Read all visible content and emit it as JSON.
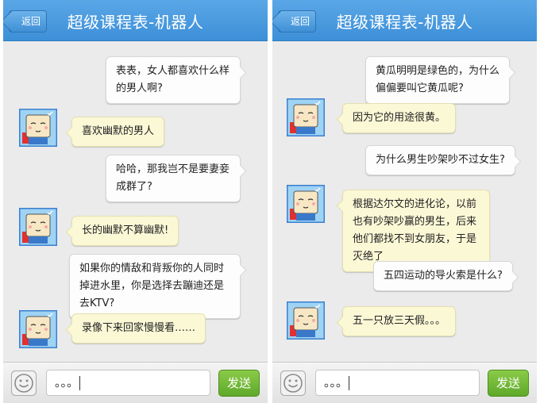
{
  "colors": {
    "navbar": "#4b9be0",
    "incoming_bubble": "#fbf8d6",
    "outgoing_bubble": "#fdfdfd",
    "send_button": "#6cb535"
  },
  "left": {
    "header": {
      "back_label": "返回",
      "title": "超级课程表-机器人"
    },
    "messages": [
      {
        "from": "user",
        "text": "表表，女人都喜欢什么样的男人啊?"
      },
      {
        "from": "bot",
        "text": "喜欢幽默的男人"
      },
      {
        "from": "user",
        "text": "哈哈，那我岂不是要妻妾成群了?"
      },
      {
        "from": "bot",
        "text": "长的幽默不算幽默!"
      },
      {
        "from": "user",
        "text": "如果你的情敌和背叛你的人同时掉进水里，你是选择去蹦迪还是去KTV?"
      },
      {
        "from": "bot",
        "text": "录像下来回家慢慢看……"
      }
    ],
    "input": {
      "value": "。。。",
      "send_label": "发送",
      "emoji_icon": "smiley-icon"
    }
  },
  "right": {
    "header": {
      "back_label": "返回",
      "title": "超级课程表-机器人"
    },
    "messages": [
      {
        "from": "user",
        "text": "黄瓜明明是绿色的，为什么偏偏要叫它黄瓜呢?"
      },
      {
        "from": "bot",
        "text": "因为它的用途很黄。"
      },
      {
        "from": "user",
        "text": "为什么男生吵架吵不过女生?"
      },
      {
        "from": "bot",
        "text": "根据达尔文的进化论，以前也有吵架吵赢的男生，后来他们都找不到女朋友，于是灭绝了"
      },
      {
        "from": "user",
        "text": "五四运动的导火索是什么?"
      },
      {
        "from": "bot",
        "text": "五一只放三天假。。。"
      }
    ],
    "input": {
      "value": "。。。",
      "send_label": "发送",
      "emoji_icon": "smiley-icon"
    }
  }
}
